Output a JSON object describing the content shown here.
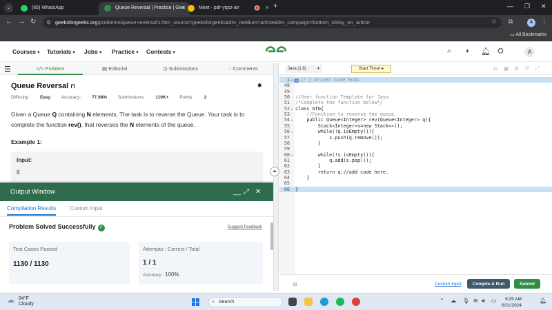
{
  "browser": {
    "tabs": [
      {
        "title": "(65) WhatsApp",
        "color": "#25d366"
      },
      {
        "title": "Queue Reversal | Practice | Gee",
        "color": "#2f8d46"
      },
      {
        "title": "Meet - pdr-yqsz-air",
        "color": "#fbbc04"
      }
    ],
    "new_tab": "+",
    "url_host": "geeksforgeeks.org",
    "url_rest": "/problems/queue-reversal/1?itm_source=geeksforgeeks&itm_medium=article&itm_campaign=bottom_sticky_on_article",
    "profile_letter": "A",
    "all_bookmarks": "All Bookmarks"
  },
  "site": {
    "nav": [
      "Courses",
      "Tutorials",
      "Jobs",
      "Practice",
      "Contests"
    ],
    "avatar_letter": "A",
    "brand_color": "#2f8d46"
  },
  "left_tabs": [
    "Problem",
    "Editorial",
    "Submissions",
    "Comments"
  ],
  "problem": {
    "title": "Queue Reversal",
    "difficulty_label": "Difficulty:",
    "difficulty": "Easy",
    "accuracy_label": "Accuracy:",
    "accuracy": "77.98%",
    "submissions_label": "Submissions:",
    "submissions": "119K+",
    "points_label": "Points:",
    "points": "2",
    "desc_1": "Given a Queue ",
    "desc_q": "Q",
    "desc_2": " containing ",
    "desc_n": "N",
    "desc_3": " elements. The task is to reverse the Queue. Your task is to complete the function ",
    "desc_fn": "rev()",
    "desc_4": ", that reverses the ",
    "desc_n2": "N",
    "desc_5": " elements of the queue.",
    "example_heading": "Example 1:",
    "input_label": "Input:",
    "input_value": "6"
  },
  "output": {
    "title": "Output Window",
    "tabs": [
      "Compilation Results",
      "Custom Input"
    ],
    "status": "Problem Solved Successfully",
    "feedback": "Suggest Feedback",
    "tests_label": "Test Cases Passed",
    "tests_value": "1130 / 1130",
    "attempts_label": "Attempts : Correct / Total",
    "attempts_value": "1 / 1",
    "accuracy_label": "Accuracy :",
    "accuracy_value": "100%"
  },
  "editor": {
    "language": "Java (1.8)",
    "timer": "Start Timer",
    "lines": [
      {
        "n": "1",
        "fold": true,
        "text": "// } Driver Code Ends",
        "hl": true,
        "tag": true
      },
      {
        "n": "48",
        "text": ""
      },
      {
        "n": "49",
        "text": ""
      },
      {
        "n": "50",
        "text": "//User function Template for Java"
      },
      {
        "n": "51",
        "text": "/*Complete the function below*/"
      },
      {
        "n": "52",
        "fold": true,
        "text": "class GfG{"
      },
      {
        "n": "53",
        "text": "    //Function to reverse the queue."
      },
      {
        "n": "54",
        "fold": true,
        "text": "    public Queue<Integer> rev(Queue<Integer> q){"
      },
      {
        "n": "55",
        "text": "        Stack<Integer>s=new Stack<>();"
      },
      {
        "n": "56",
        "fold": true,
        "text": "        while(!q.isEmpty()){"
      },
      {
        "n": "57",
        "text": "            s.push(q.remove());"
      },
      {
        "n": "58",
        "text": "        }"
      },
      {
        "n": "59",
        "text": ""
      },
      {
        "n": "60",
        "fold": true,
        "text": "        while(!s.isEmpty()){"
      },
      {
        "n": "61",
        "text": "            q.add(s.pop());"
      },
      {
        "n": "62",
        "text": "        }"
      },
      {
        "n": "63",
        "text": "        return q;//add code here."
      },
      {
        "n": "64",
        "text": "    }"
      },
      {
        "n": "65",
        "text": ""
      },
      {
        "n": "66",
        "text": "}",
        "hl": true
      }
    ],
    "custom_input": "Custom Input",
    "compile_run": "Compile & Run",
    "submit": "Submit"
  },
  "taskbar": {
    "temp": "84°F",
    "weather": "Cloudy",
    "search": "Search",
    "time": "9:25 AM",
    "date": "6/21/2024"
  }
}
